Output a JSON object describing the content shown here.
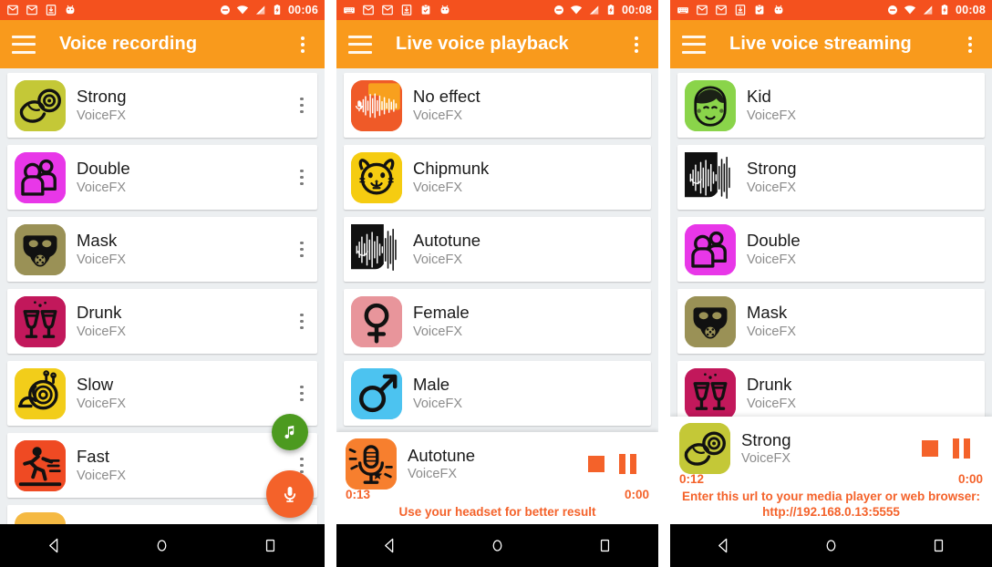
{
  "app": {
    "brand_subtitle": "VoiceFX"
  },
  "colors": {
    "status_bar": "#f4511e",
    "app_bar": "#f99a1c",
    "accent_orange": "#f4622a",
    "fab_green": "#4c9a1f",
    "list_bg": "#eceff1",
    "nav_bar": "#000000"
  },
  "panels": [
    {
      "id": "voice-recording",
      "status": {
        "time": "00:06",
        "left_icons": [
          "gmail-icon",
          "gmail-icon",
          "download-icon",
          "android-robot-icon"
        ],
        "right_icons": [
          "do-not-disturb-icon",
          "wifi-icon",
          "signal-icon",
          "battery-charging-icon"
        ]
      },
      "appbar": {
        "title": "Voice recording",
        "menu_icon": "hamburger-icon",
        "overflow_icon": "kebab-menu-icon"
      },
      "items": [
        {
          "name": "Strong",
          "sub": "VoiceFX",
          "icon": "bicep-strong-icon",
          "bg": "#c4c837",
          "shape": "rounded",
          "has_menu": true
        },
        {
          "name": "Double",
          "sub": "VoiceFX",
          "icon": "two-people-icon",
          "bg": "#e837e8",
          "shape": "rounded",
          "has_menu": true
        },
        {
          "name": "Mask",
          "sub": "VoiceFX",
          "icon": "gas-mask-icon",
          "bg": "#9a9156",
          "shape": "rounded",
          "has_menu": true
        },
        {
          "name": "Drunk",
          "sub": "VoiceFX",
          "icon": "wine-glasses-icon",
          "bg": "#c2185b",
          "shape": "rounded",
          "has_menu": true
        },
        {
          "name": "Slow",
          "sub": "VoiceFX",
          "icon": "snail-icon",
          "bg": "#f2cd1a",
          "shape": "rounded",
          "has_menu": true
        },
        {
          "name": "Fast",
          "sub": "VoiceFX",
          "icon": "running-person-icon",
          "bg": "#ef4a23",
          "shape": "rounded",
          "has_menu": true
        }
      ],
      "partial_item": {
        "bg": "#f5b942"
      },
      "fabs": [
        {
          "name": "music-fab",
          "icon": "music-note-icon",
          "color": "#4c9a1f"
        },
        {
          "name": "record-fab",
          "icon": "microphone-icon",
          "color": "#f4622a"
        }
      ],
      "player": null
    },
    {
      "id": "live-voice-playback",
      "status": {
        "time": "00:08",
        "left_icons": [
          "keyboard-icon",
          "gmail-icon",
          "gmail-icon",
          "download-icon",
          "clipboard-check-icon",
          "android-robot-icon"
        ],
        "right_icons": [
          "do-not-disturb-icon",
          "wifi-icon",
          "signal-icon",
          "battery-charging-icon"
        ]
      },
      "appbar": {
        "title": "Live voice playback",
        "menu_icon": "hamburger-icon",
        "overflow_icon": "kebab-menu-icon"
      },
      "items": [
        {
          "name": "No effect",
          "sub": "VoiceFX",
          "icon": "mic-waveform-icon",
          "bg": "#ef5a28",
          "shape": "rounded",
          "has_menu": false
        },
        {
          "name": "Chipmunk",
          "sub": "VoiceFX",
          "icon": "chipmunk-icon",
          "bg": "#f5cc11",
          "shape": "rounded",
          "has_menu": false
        },
        {
          "name": "Autotune",
          "sub": "VoiceFX",
          "icon": "black-waveform-icon",
          "bg": "#111111",
          "shape": "square",
          "has_menu": false
        },
        {
          "name": "Female",
          "sub": "VoiceFX",
          "icon": "venus-symbol-icon",
          "bg": "#e8959b",
          "shape": "rounded",
          "has_menu": false
        },
        {
          "name": "Male",
          "sub": "VoiceFX",
          "icon": "mars-symbol-icon",
          "bg": "#4cc3f0",
          "shape": "rounded",
          "has_menu": false
        }
      ],
      "partial_item": null,
      "fabs": [],
      "player": {
        "name": "Autotune",
        "sub": "VoiceFX",
        "icon": "shiny-microphone-icon",
        "bg": "#f77f2e",
        "elapsed": "0:13",
        "remaining": "0:00",
        "stop_icon": "stop-icon",
        "pause_icon": "pause-icon",
        "note_lines": [
          "Use your headset for better result"
        ]
      }
    },
    {
      "id": "live-voice-streaming",
      "status": {
        "time": "00:08",
        "left_icons": [
          "keyboard-icon",
          "gmail-icon",
          "gmail-icon",
          "download-icon",
          "clipboard-check-icon",
          "android-robot-icon"
        ],
        "right_icons": [
          "do-not-disturb-icon",
          "wifi-icon",
          "signal-icon",
          "battery-charging-icon"
        ]
      },
      "appbar": {
        "title": "Live voice streaming",
        "menu_icon": "hamburger-icon",
        "overflow_icon": "kebab-menu-icon"
      },
      "items": [
        {
          "name": "Kid",
          "sub": "VoiceFX",
          "icon": "kid-face-icon",
          "bg": "#8ad44a",
          "shape": "rounded",
          "has_menu": false
        },
        {
          "name": "Strong",
          "sub": "VoiceFX",
          "icon": "black-waveform-icon",
          "bg": "#111111",
          "shape": "square",
          "has_menu": false
        },
        {
          "name": "Double",
          "sub": "VoiceFX",
          "icon": "two-people-icon",
          "bg": "#e837e8",
          "shape": "rounded",
          "has_menu": false
        },
        {
          "name": "Mask",
          "sub": "VoiceFX",
          "icon": "gas-mask-icon",
          "bg": "#9a9156",
          "shape": "rounded",
          "has_menu": false
        },
        {
          "name": "Drunk",
          "sub": "VoiceFX",
          "icon": "wine-glasses-icon",
          "bg": "#c2185b",
          "shape": "rounded",
          "has_menu": false
        }
      ],
      "partial_item": null,
      "fabs": [],
      "player": {
        "name": "Strong",
        "sub": "VoiceFX",
        "icon": "bicep-strong-icon",
        "bg": "#c4c837",
        "elapsed": "0:12",
        "remaining": "0:00",
        "stop_icon": "stop-icon",
        "pause_icon": "pause-icon",
        "note_lines": [
          "Enter this url to your media player or web browser:",
          "http://192.168.0.13:5555"
        ]
      }
    }
  ],
  "navbar": {
    "back_label": "back-triangle-icon",
    "home_label": "home-circle-icon",
    "recents_label": "recents-square-icon"
  }
}
